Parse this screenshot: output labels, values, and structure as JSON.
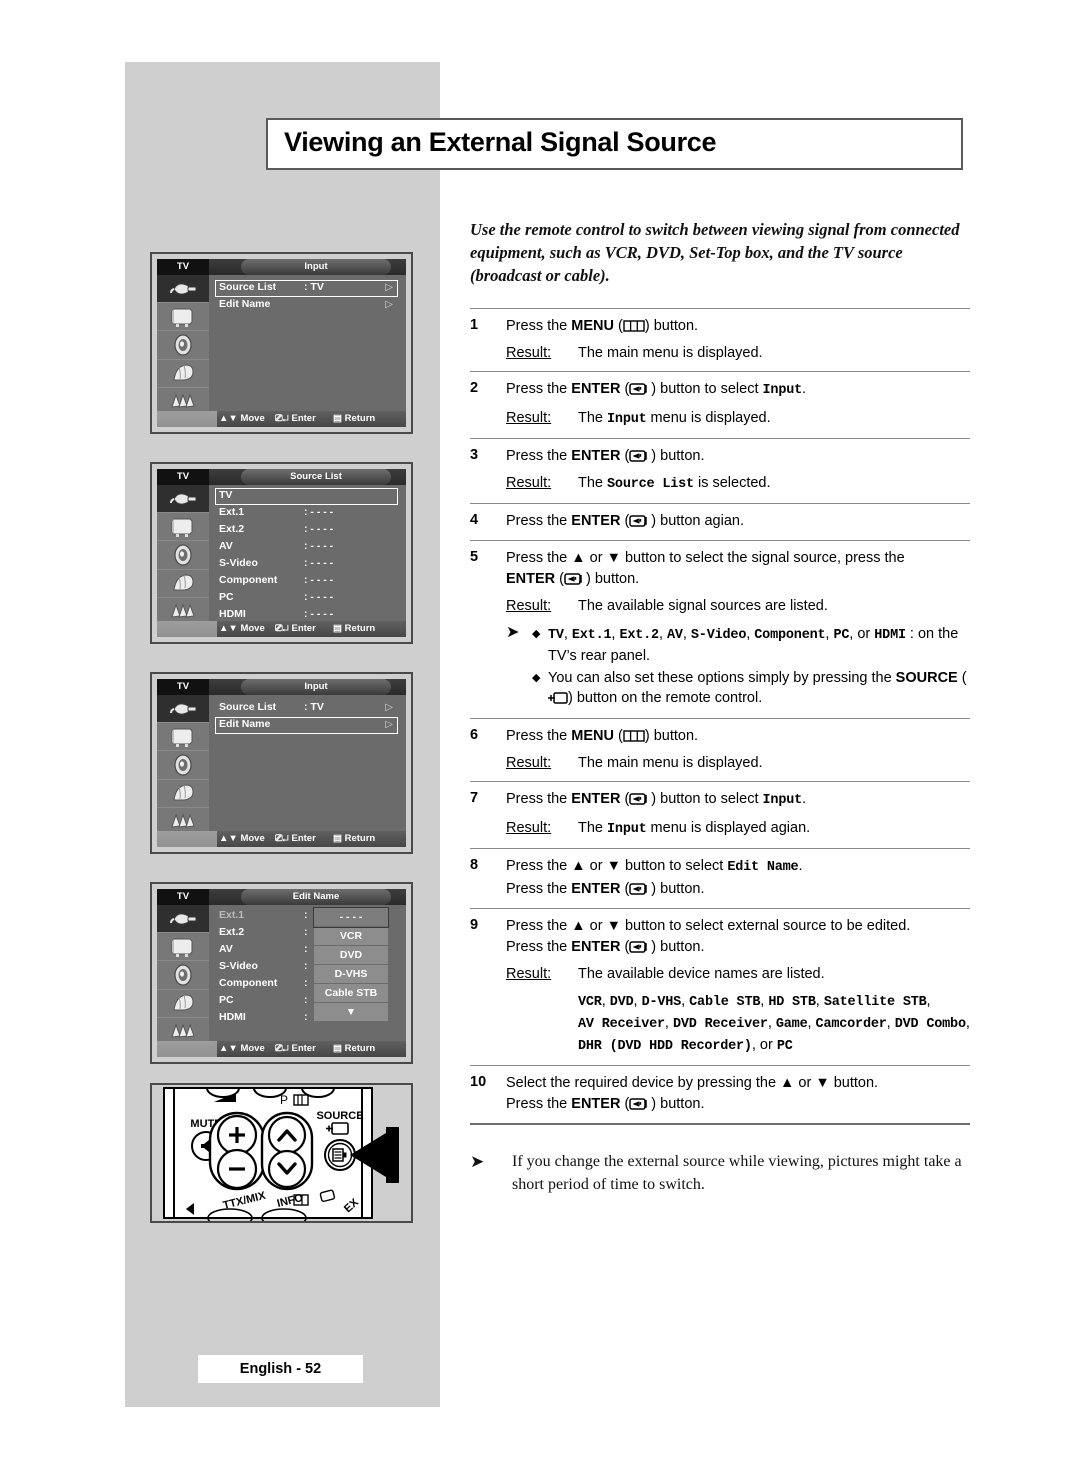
{
  "page": {
    "title": "Viewing an External Signal Source",
    "footer": "English - 52",
    "intro": "Use the remote control to switch between viewing signal from connected equipment, such as VCR, DVD, Set-Top box, and the TV source (broadcast or cable)."
  },
  "osd": {
    "tv_label": "TV",
    "bottom": {
      "move": "Move",
      "enter": "Enter",
      "return": "Return"
    },
    "panel1": {
      "caption": "Input",
      "rows": [
        {
          "label": "Source List",
          "value": ": TV",
          "arrow": "▷",
          "highlighted": true
        },
        {
          "label": "Edit Name",
          "value": "",
          "arrow": "▷",
          "highlighted": false
        }
      ]
    },
    "panel2": {
      "caption": "Source List",
      "rows": [
        {
          "label": "TV",
          "value": "",
          "highlighted": true
        },
        {
          "label": "Ext.1",
          "value": ": - - - -",
          "highlighted": false
        },
        {
          "label": "Ext.2",
          "value": ": - - - -",
          "highlighted": false
        },
        {
          "label": "AV",
          "value": ": - - - -",
          "highlighted": false
        },
        {
          "label": "S-Video",
          "value": ": - - - -",
          "highlighted": false
        },
        {
          "label": "Component",
          "value": ": - - - -",
          "highlighted": false
        },
        {
          "label": "PC",
          "value": ": - - - -",
          "highlighted": false
        },
        {
          "label": "HDMI",
          "value": ": - - - -",
          "highlighted": false
        }
      ]
    },
    "panel3": {
      "caption": "Input",
      "rows": [
        {
          "label": "Source List",
          "value": ": TV",
          "arrow": "▷",
          "highlighted": false
        },
        {
          "label": "Edit Name",
          "value": "",
          "arrow": "▷",
          "highlighted": true
        }
      ]
    },
    "panel4": {
      "caption": "Edit Name",
      "rows": [
        {
          "label": "Ext.1",
          "value": ":",
          "dim": true
        },
        {
          "label": "Ext.2",
          "value": ":",
          "dim": false
        },
        {
          "label": "AV",
          "value": ":",
          "dim": false
        },
        {
          "label": "S-Video",
          "value": ":",
          "dim": false
        },
        {
          "label": "Component",
          "value": ":",
          "dim": false
        },
        {
          "label": "PC",
          "value": ":",
          "dim": false
        },
        {
          "label": "HDMI",
          "value": ":",
          "dim": false
        }
      ],
      "dropdown": [
        "- - - -",
        "VCR",
        "DVD",
        "D-VHS",
        "Cable STB",
        "▼"
      ]
    }
  },
  "remote": {
    "mute_label": "MUTE",
    "p_label": "P",
    "source_label": "SOURCE",
    "ttx_label": "TTX/MIX",
    "info_label": "INFO",
    "plus": "+",
    "minus": "−"
  },
  "steps": [
    {
      "num": "1",
      "lines": [
        {
          "parts": [
            {
              "t": "Press the ",
              "s": "n"
            },
            {
              "t": "MENU",
              "s": "b"
            },
            {
              "t": " (",
              "s": "n"
            },
            {
              "t": "MENU_ICON",
              "s": "icon-menu"
            },
            {
              "t": ") button.",
              "s": "n"
            }
          ]
        }
      ],
      "result_label": "Result:",
      "result": [
        {
          "t": "The main menu is displayed.",
          "s": "n"
        }
      ]
    },
    {
      "num": "2",
      "lines": [
        {
          "parts": [
            {
              "t": "Press the ",
              "s": "n"
            },
            {
              "t": "ENTER",
              "s": "b"
            },
            {
              "t": " (",
              "s": "n"
            },
            {
              "t": "ENTER_ICON",
              "s": "icon-enter"
            },
            {
              "t": ") button to select ",
              "s": "n"
            },
            {
              "t": "Input",
              "s": "m"
            },
            {
              "t": ".",
              "s": "n"
            }
          ]
        }
      ],
      "result_label": "Result:",
      "result": [
        {
          "t": "The ",
          "s": "n"
        },
        {
          "t": "Input",
          "s": "m"
        },
        {
          "t": " menu is displayed.",
          "s": "n"
        }
      ]
    },
    {
      "num": "3",
      "lines": [
        {
          "parts": [
            {
              "t": "Press the ",
              "s": "n"
            },
            {
              "t": "ENTER",
              "s": "b"
            },
            {
              "t": " (",
              "s": "n"
            },
            {
              "t": "ENTER_ICON",
              "s": "icon-enter"
            },
            {
              "t": ") button.",
              "s": "n"
            }
          ]
        }
      ],
      "result_label": "Result:",
      "result": [
        {
          "t": "The ",
          "s": "n"
        },
        {
          "t": "Source List",
          "s": "m"
        },
        {
          "t": " is selected.",
          "s": "n"
        }
      ]
    },
    {
      "num": "4",
      "lines": [
        {
          "parts": [
            {
              "t": "Press the ",
              "s": "n"
            },
            {
              "t": "ENTER",
              "s": "b"
            },
            {
              "t": " (",
              "s": "n"
            },
            {
              "t": "ENTER_ICON",
              "s": "icon-enter"
            },
            {
              "t": ") button agian.",
              "s": "n"
            }
          ]
        }
      ],
      "result_label": "",
      "result": []
    },
    {
      "num": "5",
      "lines": [
        {
          "parts": [
            {
              "t": "Press the ",
              "s": "n"
            },
            {
              "t": "▲",
              "s": "n"
            },
            {
              "t": " or ",
              "s": "n"
            },
            {
              "t": "▼",
              "s": "n"
            },
            {
              "t": " button to select the signal source, press the",
              "s": "n"
            }
          ]
        },
        {
          "parts": [
            {
              "t": "ENTER",
              "s": "b"
            },
            {
              "t": " (",
              "s": "n"
            },
            {
              "t": "ENTER_ICON",
              "s": "icon-enter"
            },
            {
              "t": ") button.",
              "s": "n"
            }
          ]
        }
      ],
      "result_label": "Result:",
      "result": [
        {
          "t": "The available signal sources are listed.",
          "s": "n"
        }
      ],
      "notes": [
        [
          {
            "t": "TV",
            "s": "m"
          },
          {
            "t": ", ",
            "s": "n"
          },
          {
            "t": "Ext.1",
            "s": "m"
          },
          {
            "t": ", ",
            "s": "n"
          },
          {
            "t": "Ext.2",
            "s": "m"
          },
          {
            "t": ", ",
            "s": "n"
          },
          {
            "t": "AV",
            "s": "m"
          },
          {
            "t": ", ",
            "s": "n"
          },
          {
            "t": "S-Video",
            "s": "m"
          },
          {
            "t": ", ",
            "s": "n"
          },
          {
            "t": "Component",
            "s": "m"
          },
          {
            "t": ", ",
            "s": "n"
          },
          {
            "t": "PC",
            "s": "m"
          },
          {
            "t": ", or ",
            "s": "n"
          },
          {
            "t": "HDMI",
            "s": "m"
          },
          {
            "t": " : on the TV’s rear panel.",
            "s": "n"
          }
        ],
        [
          {
            "t": "You can also set these options simply by pressing the ",
            "s": "n"
          },
          {
            "t": "SOURCE",
            "s": "b"
          },
          {
            "t": " (",
            "s": "n"
          },
          {
            "t": "SOURCE_ICON",
            "s": "icon-source"
          },
          {
            "t": ") button on the remote control.",
            "s": "n"
          }
        ]
      ]
    },
    {
      "num": "6",
      "lines": [
        {
          "parts": [
            {
              "t": "Press the ",
              "s": "n"
            },
            {
              "t": "MENU",
              "s": "b"
            },
            {
              "t": " (",
              "s": "n"
            },
            {
              "t": "MENU_ICON",
              "s": "icon-menu"
            },
            {
              "t": ") button.",
              "s": "n"
            }
          ]
        }
      ],
      "result_label": "Result:",
      "result": [
        {
          "t": "The main menu is displayed.",
          "s": "n"
        }
      ]
    },
    {
      "num": "7",
      "lines": [
        {
          "parts": [
            {
              "t": "Press the ",
              "s": "n"
            },
            {
              "t": "ENTER",
              "s": "b"
            },
            {
              "t": " (",
              "s": "n"
            },
            {
              "t": "ENTER_ICON",
              "s": "icon-enter"
            },
            {
              "t": ") button to select ",
              "s": "n"
            },
            {
              "t": "Input",
              "s": "m"
            },
            {
              "t": ".",
              "s": "n"
            }
          ]
        }
      ],
      "result_label": "Result:",
      "result": [
        {
          "t": "The ",
          "s": "n"
        },
        {
          "t": "Input",
          "s": "m"
        },
        {
          "t": " menu is displayed agian.",
          "s": "n"
        }
      ]
    },
    {
      "num": "8",
      "lines": [
        {
          "parts": [
            {
              "t": "Press the ",
              "s": "n"
            },
            {
              "t": "▲",
              "s": "n"
            },
            {
              "t": " or ",
              "s": "n"
            },
            {
              "t": "▼",
              "s": "n"
            },
            {
              "t": " button to select ",
              "s": "n"
            },
            {
              "t": "Edit Name",
              "s": "m"
            },
            {
              "t": ".",
              "s": "n"
            }
          ]
        },
        {
          "parts": [
            {
              "t": "Press the ",
              "s": "n"
            },
            {
              "t": "ENTER",
              "s": "b"
            },
            {
              "t": " (",
              "s": "n"
            },
            {
              "t": "ENTER_ICON",
              "s": "icon-enter"
            },
            {
              "t": ") button.",
              "s": "n"
            }
          ]
        }
      ],
      "result_label": "",
      "result": []
    },
    {
      "num": "9",
      "lines": [
        {
          "parts": [
            {
              "t": "Press the ",
              "s": "n"
            },
            {
              "t": "▲",
              "s": "n"
            },
            {
              "t": " or ",
              "s": "n"
            },
            {
              "t": "▼",
              "s": "n"
            },
            {
              "t": " button to select external source to be edited.",
              "s": "n"
            }
          ]
        },
        {
          "parts": [
            {
              "t": "Press the ",
              "s": "n"
            },
            {
              "t": "ENTER",
              "s": "b"
            },
            {
              "t": " (",
              "s": "n"
            },
            {
              "t": "ENTER_ICON",
              "s": "icon-enter"
            },
            {
              "t": ") button.",
              "s": "n"
            }
          ]
        }
      ],
      "result_label": "Result:",
      "result": [
        {
          "t": "The available device names are listed.",
          "s": "n"
        }
      ],
      "devices": [
        {
          "t": "VCR",
          "s": "m"
        },
        {
          "t": ", ",
          "s": "n"
        },
        {
          "t": "DVD",
          "s": "m"
        },
        {
          "t": ", ",
          "s": "n"
        },
        {
          "t": "D-VHS",
          "s": "m"
        },
        {
          "t": ", ",
          "s": "n"
        },
        {
          "t": "Cable STB",
          "s": "m"
        },
        {
          "t": ", ",
          "s": "n"
        },
        {
          "t": "HD STB",
          "s": "m"
        },
        {
          "t": ", ",
          "s": "n"
        },
        {
          "t": "Satellite STB",
          "s": "m"
        },
        {
          "t": ", ",
          "s": "n"
        },
        {
          "t": "AV Receiver",
          "s": "m"
        },
        {
          "t": ", ",
          "s": "n"
        },
        {
          "t": "DVD Receiver",
          "s": "m"
        },
        {
          "t": ", ",
          "s": "n"
        },
        {
          "t": "Game",
          "s": "m"
        },
        {
          "t": ", ",
          "s": "n"
        },
        {
          "t": "Camcorder",
          "s": "m"
        },
        {
          "t": ", ",
          "s": "n"
        },
        {
          "t": "DVD Combo",
          "s": "m"
        },
        {
          "t": ", ",
          "s": "n"
        },
        {
          "t": "DHR (DVD HDD Recorder)",
          "s": "m"
        },
        {
          "t": ", or ",
          "s": "n"
        },
        {
          "t": "PC",
          "s": "m"
        }
      ]
    },
    {
      "num": "10",
      "lines": [
        {
          "parts": [
            {
              "t": "Select the required device by pressing the ",
              "s": "n"
            },
            {
              "t": "▲",
              "s": "n"
            },
            {
              "t": " or ",
              "s": "n"
            },
            {
              "t": "▼",
              "s": "n"
            },
            {
              "t": " button.",
              "s": "n"
            }
          ]
        },
        {
          "parts": [
            {
              "t": "Press the ",
              "s": "n"
            },
            {
              "t": "ENTER",
              "s": "b"
            },
            {
              "t": " (",
              "s": "n"
            },
            {
              "t": "ENTER_ICON",
              "s": "icon-enter"
            },
            {
              "t": ") button.",
              "s": "n"
            }
          ]
        }
      ],
      "result_label": "",
      "result": []
    }
  ],
  "final_note": "If you change the external source while viewing, pictures might take a short period of time to switch.",
  "colors": {
    "page_gray": "#cfcfcf",
    "osd_bg": "#6b6b6b",
    "osd_icon_bar": "#787878",
    "osd_selected": "#2f2f2f",
    "text": "#000000"
  }
}
